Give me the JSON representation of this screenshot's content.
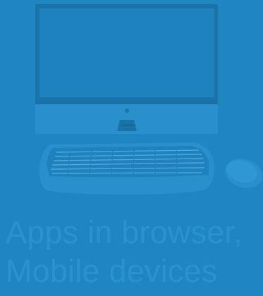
{
  "caption": {
    "line1": "Apps in browser,",
    "line2": "Mobile devices"
  },
  "icons": {
    "monitor": "computer-monitor-icon",
    "keyboard": "keyboard-icon",
    "mouse": "mouse-icon"
  },
  "colors": {
    "background": "#1f86c1",
    "monitor_frame": "#1a73a8",
    "screen": "#1d82bd",
    "stand": "#2b92cd",
    "keyboard": "#2a90cb",
    "keys": "#52a8db",
    "caption_text": "#2a93cf"
  }
}
